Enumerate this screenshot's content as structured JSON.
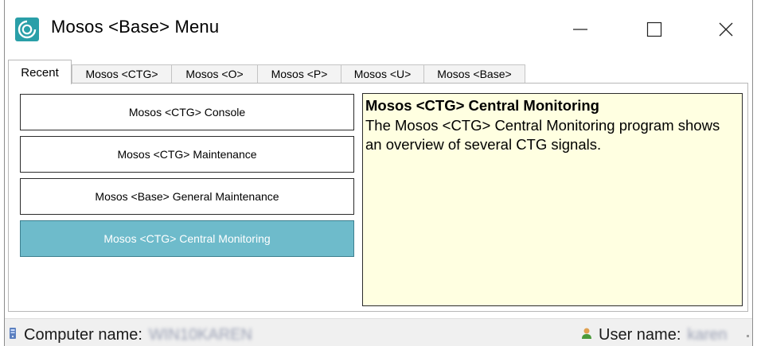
{
  "window": {
    "title": "Mosos <Base> Menu",
    "minimize_glyph": "—",
    "maximize_glyph": "☐",
    "close_glyph": "✕"
  },
  "tabs": [
    {
      "label": "Recent",
      "active": true
    },
    {
      "label": "Mosos <CTG>",
      "active": false
    },
    {
      "label": "Mosos <O>",
      "active": false
    },
    {
      "label": "Mosos <P>",
      "active": false
    },
    {
      "label": "Mosos <U>",
      "active": false
    },
    {
      "label": "Mosos <Base>",
      "active": false
    }
  ],
  "programs": [
    {
      "label": "Mosos <CTG> Console",
      "selected": false
    },
    {
      "label": "Mosos <CTG> Maintenance",
      "selected": false
    },
    {
      "label": "Mosos <Base> General Maintenance",
      "selected": false
    },
    {
      "label": "Mosos <CTG> Central Monitoring",
      "selected": true
    }
  ],
  "description": {
    "title": "Mosos <CTG> Central Monitoring",
    "body": "The Mosos <CTG> Central Monitoring program shows an overview of several CTG signals."
  },
  "status": {
    "computer_label": "Computer name:",
    "computer_value": "WIN10KAREN",
    "user_label": "User name:",
    "user_value": "karen"
  },
  "colors": {
    "selected_button": "#6ebbcb",
    "description_background": "#ffffe1",
    "app_icon": "#2a9fa8"
  },
  "icons": {
    "app": "mosos-logo-icon",
    "computer": "computer-icon",
    "user": "user-icon"
  }
}
